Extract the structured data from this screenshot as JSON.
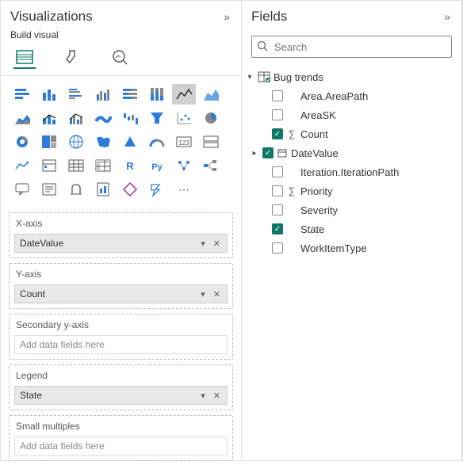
{
  "viz": {
    "title": "Visualizations",
    "subLabel": "Build visual",
    "collapseGlyph": "»"
  },
  "wells": {
    "xaxis": {
      "label": "X-axis",
      "value": "DateValue"
    },
    "yaxis": {
      "label": "Y-axis",
      "value": "Count"
    },
    "secyaxis": {
      "label": "Secondary y-axis",
      "placeholder": "Add data fields here"
    },
    "legend": {
      "label": "Legend",
      "value": "State"
    },
    "smallmult": {
      "label": "Small multiples",
      "placeholder": "Add data fields here"
    }
  },
  "fields": {
    "title": "Fields",
    "collapseGlyph": "»",
    "searchPlaceholder": "Search",
    "table": "Bug trends",
    "items": {
      "areaPath": {
        "label": "Area.AreaPath"
      },
      "areaSK": {
        "label": "AreaSK"
      },
      "count": {
        "label": "Count"
      },
      "dateValue": {
        "label": "DateValue"
      },
      "iterPath": {
        "label": "Iteration.IterationPath"
      },
      "priority": {
        "label": "Priority"
      },
      "severity": {
        "label": "Severity"
      },
      "state": {
        "label": "State"
      },
      "witype": {
        "label": "WorkItemType"
      }
    }
  }
}
